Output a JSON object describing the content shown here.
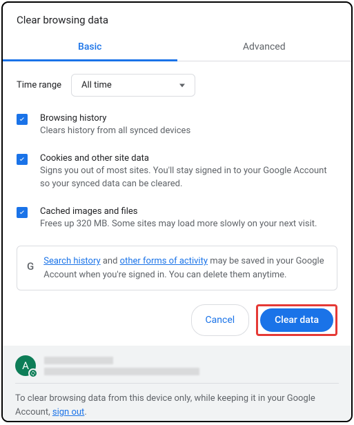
{
  "title": "Clear browsing data",
  "tabs": {
    "basic": "Basic",
    "advanced": "Advanced"
  },
  "time": {
    "label": "Time range",
    "value": "All time"
  },
  "items": [
    {
      "title": "Browsing history",
      "sub": "Clears history from all synced devices"
    },
    {
      "title": "Cookies and other site data",
      "sub": "Signs you out of most sites. You'll stay signed in to your Google Account so your synced data can be cleared."
    },
    {
      "title": "Cached images and files",
      "sub": "Frees up 320 MB. Some sites may load more slowly on your next visit."
    }
  ],
  "info": {
    "link1": "Search history",
    "mid1": " and ",
    "link2": "other forms of activity",
    "rest": " may be saved in your Google Account when you're signed in. You can delete them anytime."
  },
  "buttons": {
    "cancel": "Cancel",
    "clear": "Clear data"
  },
  "avatar_initial": "A",
  "footer": {
    "pre": "To clear browsing data from this device only, while keeping it in your Google Account, ",
    "link": "sign out",
    "post": "."
  }
}
